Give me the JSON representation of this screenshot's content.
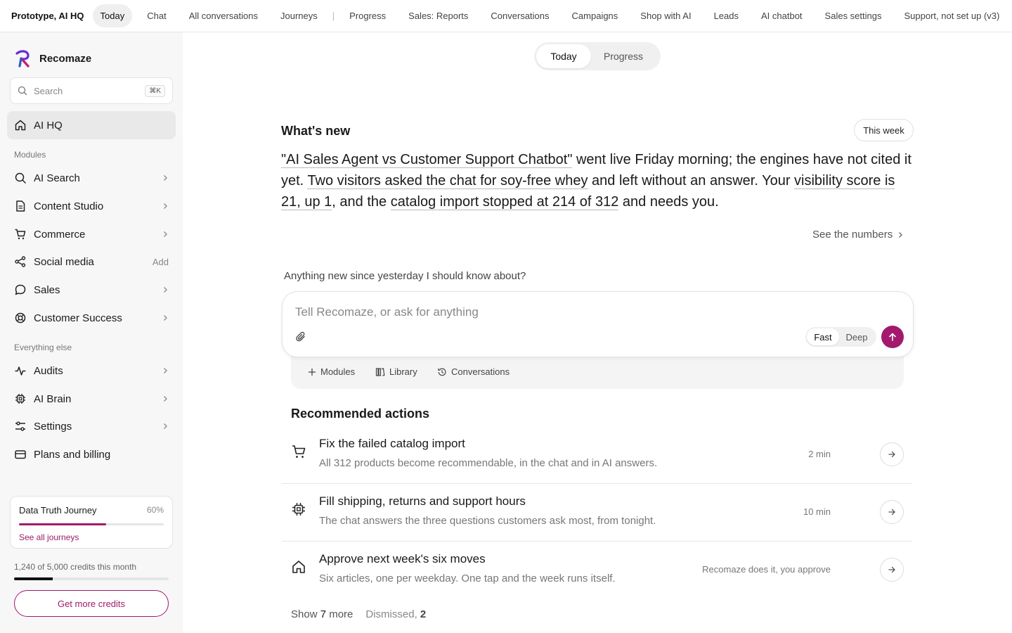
{
  "topnav": {
    "brand": "Prototype, AI HQ",
    "links": [
      "Today",
      "Chat",
      "All conversations",
      "Journeys",
      "Progress",
      "Sales: Reports",
      "Conversations",
      "Campaigns",
      "Shop with AI",
      "Leads",
      "AI chatbot",
      "Sales settings",
      "Support, not set up (v3)"
    ],
    "separator": "|"
  },
  "sidebar": {
    "logo_text": "Recomaze",
    "search": {
      "placeholder": "Search",
      "shortcut": "⌘K"
    },
    "primary": {
      "label": "AI HQ",
      "icon": "home-icon"
    },
    "modules_label": "Modules",
    "modules": [
      {
        "label": "AI Search",
        "icon": "search-icon",
        "trail": "chevron"
      },
      {
        "label": "Content Studio",
        "icon": "document-icon",
        "trail": "chevron"
      },
      {
        "label": "Commerce",
        "icon": "cart-icon",
        "trail": "chevron"
      },
      {
        "label": "Social media",
        "icon": "share-icon",
        "trail": "Add"
      },
      {
        "label": "Sales",
        "icon": "chat-bubble-icon",
        "trail": "chevron"
      },
      {
        "label": "Customer Success",
        "icon": "lifebuoy-icon",
        "trail": "chevron"
      }
    ],
    "else_label": "Everything else",
    "else": [
      {
        "label": "Audits",
        "icon": "pulse-icon",
        "trail": "chevron"
      },
      {
        "label": "AI Brain",
        "icon": "chip-icon",
        "trail": "chevron"
      },
      {
        "label": "Settings",
        "icon": "sliders-icon",
        "trail": "chevron"
      },
      {
        "label": "Plans and billing",
        "icon": "card-icon",
        "trail": "none"
      }
    ],
    "journey": {
      "title": "Data Truth Journey",
      "percent_label": "60%",
      "progress": 0.6,
      "link": "See all journeys"
    },
    "credits": {
      "text": "1,240 of 5,000 credits this month",
      "used": 1240,
      "total": 5000
    },
    "get_credits": "Get more credits"
  },
  "main": {
    "tabs": {
      "today": "Today",
      "progress": "Progress"
    },
    "whats_new": {
      "title": "What's new",
      "period": "This week",
      "parts": [
        {
          "text": "\"AI Sales Agent vs Customer Support Chatbot\"",
          "u": true
        },
        {
          "text": " went live Friday morning; the engines have not cited it yet. ",
          "u": false
        },
        {
          "text": "Two visitors asked the chat for soy-free whey",
          "u": true
        },
        {
          "text": " and left without an answer. Your ",
          "u": false
        },
        {
          "text": "visibility score is 21, up 1",
          "u": true
        },
        {
          "text": ", and the ",
          "u": false
        },
        {
          "text": "catalog import stopped at 214 of 312",
          "u": true
        },
        {
          "text": " and needs you.",
          "u": false
        }
      ],
      "see_numbers": "See the numbers"
    },
    "prompt_question": "Anything new since yesterday I should know about?",
    "composer": {
      "placeholder": "Tell Recomaze, or ask for anything",
      "mode_fast": "Fast",
      "mode_deep": "Deep",
      "selected_mode": "Fast"
    },
    "tray": [
      {
        "label": "Modules",
        "icon": "plus-icon"
      },
      {
        "label": "Library",
        "icon": "library-icon"
      },
      {
        "label": "Conversations",
        "icon": "history-icon"
      }
    ],
    "recommended_title": "Recommended actions",
    "actions": [
      {
        "title": "Fix the failed catalog import",
        "desc": "All 312 products become recommendable, in the chat and in AI answers.",
        "meta": "2 min",
        "icon": "cart-icon"
      },
      {
        "title": "Fill shipping, returns and support hours",
        "desc": "The chat answers the three questions customers ask most, from tonight.",
        "meta": "10 min",
        "icon": "chip-icon"
      },
      {
        "title": "Approve next week's six moves",
        "desc": "Six articles, one per weekday. One tap and the week runs itself.",
        "meta": "Recomaze does it, you approve",
        "icon": "home-icon"
      }
    ],
    "footer": {
      "show_more_prefix": "Show ",
      "show_more_count": "7",
      "show_more_suffix": " more",
      "dismissed_label": "Dismissed, ",
      "dismissed_count": "2"
    }
  },
  "colors": {
    "accent": "#a3196e",
    "sidebar_bg": "#f7f7f7",
    "text": "#1a1a1a",
    "muted": "#777777"
  }
}
